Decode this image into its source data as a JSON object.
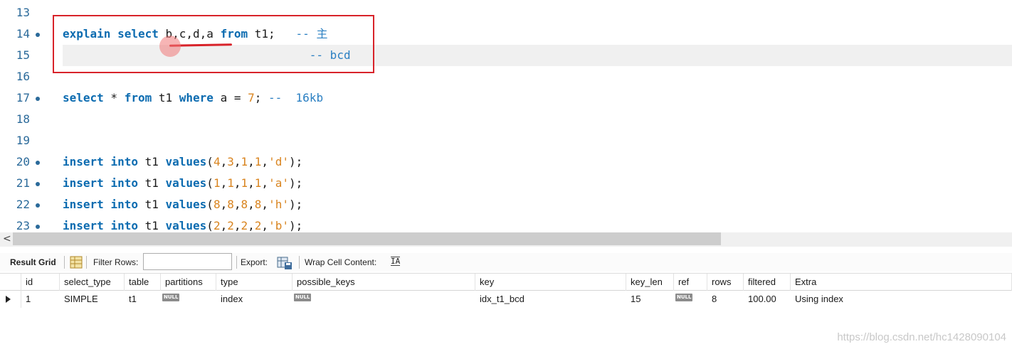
{
  "editor": {
    "lines": [
      {
        "num": "13",
        "dot": false,
        "tokens": []
      },
      {
        "num": "14",
        "dot": true,
        "tokens": [
          {
            "t": "explain",
            "c": "kw"
          },
          {
            "t": " ",
            "c": "plain"
          },
          {
            "t": "select",
            "c": "kw"
          },
          {
            "t": " b,c,d,a ",
            "c": "plain"
          },
          {
            "t": "from",
            "c": "kw"
          },
          {
            "t": " t1;   ",
            "c": "plain"
          },
          {
            "t": "-- 主",
            "c": "cmt"
          }
        ]
      },
      {
        "num": "15",
        "dot": false,
        "tokens": [
          {
            "t": "                                    ",
            "c": "plain"
          },
          {
            "t": "-- bcd",
            "c": "cmt"
          }
        ]
      },
      {
        "num": "16",
        "dot": false,
        "tokens": []
      },
      {
        "num": "17",
        "dot": true,
        "tokens": [
          {
            "t": "select",
            "c": "kw"
          },
          {
            "t": " * ",
            "c": "plain"
          },
          {
            "t": "from",
            "c": "kw"
          },
          {
            "t": " t1 ",
            "c": "plain"
          },
          {
            "t": "where",
            "c": "kw"
          },
          {
            "t": " a = ",
            "c": "plain"
          },
          {
            "t": "7",
            "c": "num"
          },
          {
            "t": "; ",
            "c": "plain"
          },
          {
            "t": "--  16kb",
            "c": "cmt"
          }
        ]
      },
      {
        "num": "18",
        "dot": false,
        "tokens": []
      },
      {
        "num": "19",
        "dot": false,
        "tokens": []
      },
      {
        "num": "20",
        "dot": true,
        "tokens": [
          {
            "t": "insert",
            "c": "kw"
          },
          {
            "t": " ",
            "c": "plain"
          },
          {
            "t": "into",
            "c": "kw"
          },
          {
            "t": " t1 ",
            "c": "plain"
          },
          {
            "t": "values",
            "c": "kw"
          },
          {
            "t": "(",
            "c": "plain"
          },
          {
            "t": "4",
            "c": "num"
          },
          {
            "t": ",",
            "c": "plain"
          },
          {
            "t": "3",
            "c": "num"
          },
          {
            "t": ",",
            "c": "plain"
          },
          {
            "t": "1",
            "c": "num"
          },
          {
            "t": ",",
            "c": "plain"
          },
          {
            "t": "1",
            "c": "num"
          },
          {
            "t": ",",
            "c": "plain"
          },
          {
            "t": "'d'",
            "c": "str"
          },
          {
            "t": ");",
            "c": "plain"
          }
        ]
      },
      {
        "num": "21",
        "dot": true,
        "tokens": [
          {
            "t": "insert",
            "c": "kw"
          },
          {
            "t": " ",
            "c": "plain"
          },
          {
            "t": "into",
            "c": "kw"
          },
          {
            "t": " t1 ",
            "c": "plain"
          },
          {
            "t": "values",
            "c": "kw"
          },
          {
            "t": "(",
            "c": "plain"
          },
          {
            "t": "1",
            "c": "num"
          },
          {
            "t": ",",
            "c": "plain"
          },
          {
            "t": "1",
            "c": "num"
          },
          {
            "t": ",",
            "c": "plain"
          },
          {
            "t": "1",
            "c": "num"
          },
          {
            "t": ",",
            "c": "plain"
          },
          {
            "t": "1",
            "c": "num"
          },
          {
            "t": ",",
            "c": "plain"
          },
          {
            "t": "'a'",
            "c": "str"
          },
          {
            "t": ");",
            "c": "plain"
          }
        ]
      },
      {
        "num": "22",
        "dot": true,
        "tokens": [
          {
            "t": "insert",
            "c": "kw"
          },
          {
            "t": " ",
            "c": "plain"
          },
          {
            "t": "into",
            "c": "kw"
          },
          {
            "t": " t1 ",
            "c": "plain"
          },
          {
            "t": "values",
            "c": "kw"
          },
          {
            "t": "(",
            "c": "plain"
          },
          {
            "t": "8",
            "c": "num"
          },
          {
            "t": ",",
            "c": "plain"
          },
          {
            "t": "8",
            "c": "num"
          },
          {
            "t": ",",
            "c": "plain"
          },
          {
            "t": "8",
            "c": "num"
          },
          {
            "t": ",",
            "c": "plain"
          },
          {
            "t": "8",
            "c": "num"
          },
          {
            "t": ",",
            "c": "plain"
          },
          {
            "t": "'h'",
            "c": "str"
          },
          {
            "t": ");",
            "c": "plain"
          }
        ]
      },
      {
        "num": "23",
        "dot": true,
        "tokens": [
          {
            "t": "insert",
            "c": "kw"
          },
          {
            "t": " ",
            "c": "plain"
          },
          {
            "t": "into",
            "c": "kw"
          },
          {
            "t": " t1 ",
            "c": "plain"
          },
          {
            "t": "values",
            "c": "kw"
          },
          {
            "t": "(",
            "c": "plain"
          },
          {
            "t": "2",
            "c": "num"
          },
          {
            "t": ",",
            "c": "plain"
          },
          {
            "t": "2",
            "c": "num"
          },
          {
            "t": ",",
            "c": "plain"
          },
          {
            "t": "2",
            "c": "num"
          },
          {
            "t": ",",
            "c": "plain"
          },
          {
            "t": "2",
            "c": "num"
          },
          {
            "t": ",",
            "c": "plain"
          },
          {
            "t": "'b'",
            "c": "str"
          },
          {
            "t": ");",
            "c": "plain"
          }
        ]
      }
    ]
  },
  "scrollbar": {
    "left_arrow": "<"
  },
  "toolbar": {
    "result_grid_label": "Result Grid",
    "filter_rows_label": "Filter Rows:",
    "filter_value": "",
    "export_label": "Export:",
    "wrap_label": "Wrap Cell Content:",
    "wrap_icon_text": "IA"
  },
  "grid": {
    "columns": [
      "id",
      "select_type",
      "table",
      "partitions",
      "type",
      "possible_keys",
      "key",
      "key_len",
      "ref",
      "rows",
      "filtered",
      "Extra"
    ],
    "rows": [
      [
        "1",
        "SIMPLE",
        "t1",
        "NULL",
        "index",
        "NULL",
        "idx_t1_bcd",
        "15",
        "NULL",
        "8",
        "100.00",
        "Using index"
      ]
    ]
  },
  "watermark": "https://blog.csdn.net/hc1428090104",
  "colors": {
    "annotation": "#d8232a",
    "keyword": "#0b6bb0",
    "number": "#d9841f",
    "comment": "#2a7fc2",
    "line_number": "#2b6a9a"
  }
}
